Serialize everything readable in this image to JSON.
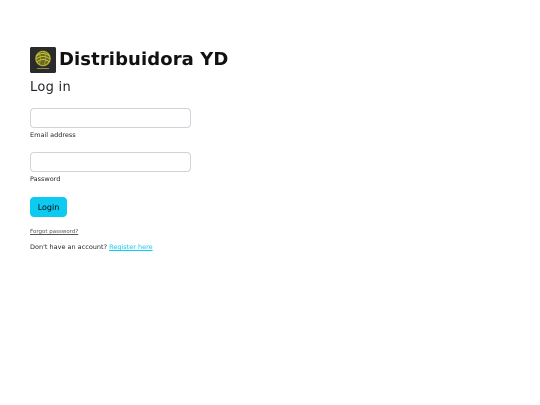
{
  "brand": {
    "name": "Distribuidora YD",
    "logo_icon": "yarn-ball-logo-icon"
  },
  "form": {
    "heading": "Log in",
    "email": {
      "label": "Email address",
      "value": "",
      "placeholder": ""
    },
    "password": {
      "label": "Password",
      "value": "",
      "placeholder": ""
    },
    "submit_label": "Login",
    "forgot_password": "Forgot password?",
    "no_account_text": "Don't have an account?",
    "register_link": "Register here"
  },
  "colors": {
    "accent": "#0dcaf0",
    "logo_background": "#2b2b2b",
    "logo_mark": "#c8c83a"
  }
}
